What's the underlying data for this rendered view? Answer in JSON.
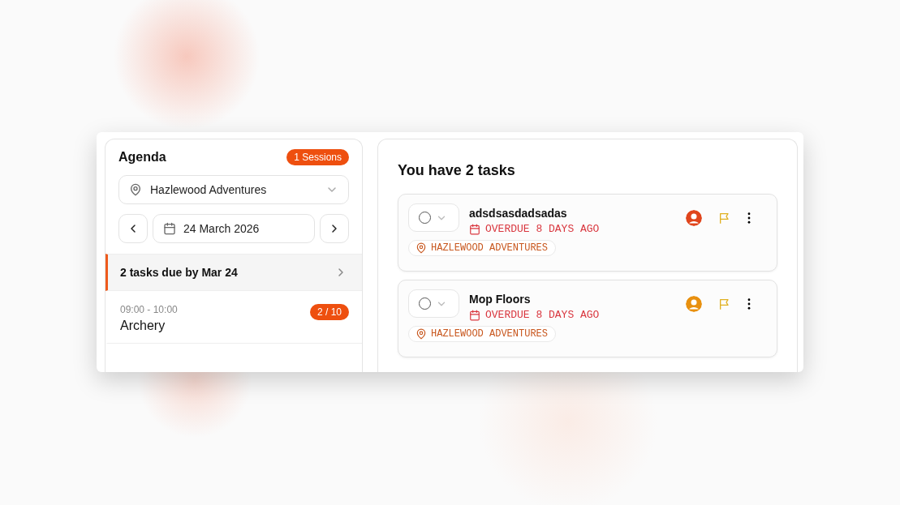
{
  "agenda": {
    "title": "Agenda",
    "badge": "1 Sessions",
    "location": "Hazlewood Adventures",
    "date": "24 March 2026",
    "items": [
      {
        "kind": "due",
        "label": "2 tasks due by Mar 24",
        "selected": true
      },
      {
        "kind": "session",
        "time": "09:00 - 10:00",
        "name": "Archery",
        "count": "2 / 10",
        "selected": false
      }
    ]
  },
  "tasks": {
    "title": "You have 2 tasks",
    "items": [
      {
        "name": "adsdsasdadsadas",
        "due": "OVERDUE 8 DAYS AGO",
        "location": "HAZLEWOOD ADVENTURES",
        "checked": false,
        "color": "#e0451c"
      },
      {
        "name": "Mop Floors",
        "due": "OVERDUE 8 DAYS AGO",
        "location": "HAZLEWOOD ADVENTURES",
        "checked": false,
        "color": "#e8900f"
      }
    ]
  }
}
